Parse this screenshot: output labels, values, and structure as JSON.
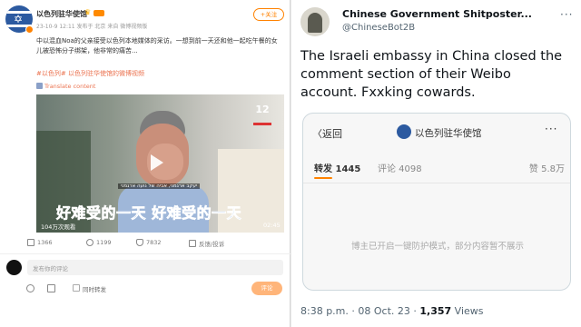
{
  "weibo": {
    "account_name": "以色列驻华使馆",
    "meta": "23-10-9 12:11  发布于 北京  来自 微博视频版",
    "follow_label": "+关注",
    "post_text": "中以混血Noa的父亲接受以色列本地媒体的采访。一想到前一天还和他一起吃午餐的女儿被恐怖分子绑架，他非常的痛苦...",
    "hashtags": "#以色列#  以色列驻华使馆的微博视频",
    "translate_label": "Translate content",
    "video": {
      "channel_logo": "12",
      "hebrew_caption": "יעקב ארגמני, אביה של נועה ארגמני",
      "subtitle": "好难受的一天 好难受的一天",
      "views": "104万次观看",
      "duration": "02:45"
    },
    "actions": {
      "repost_count": "1366",
      "comment_count": "1199",
      "like_count": "7832",
      "report_label": "反馈/投诉"
    },
    "comment_placeholder": "发布你的评论",
    "also_repost_label": "同时转发",
    "submit_label": "评论"
  },
  "tweet": {
    "display_name": "Chinese Government Shitposter...",
    "handle": "@ChineseBot2B",
    "more_label": "···",
    "text": "The Israeli embassy in China closed the comment section of their Weibo account. Fxxking cowards.",
    "embed": {
      "back_label": "〈返回",
      "account_name": "以色列驻华使馆",
      "dots": "···",
      "repost_label": "转发 1445",
      "comment_label": "评论 4098",
      "like_label": "赞 5.8万",
      "notice": "博主已开启一键防护模式，部分内容暂不展示"
    },
    "time": "8:38 p.m. · 08 Oct. 23 · ",
    "views_count": "1,357",
    "views_label": " Views"
  },
  "colors": {
    "weibo_orange": "#ff8200",
    "link_orange": "#eb7350",
    "subtitle_blue": "#2060c0"
  }
}
